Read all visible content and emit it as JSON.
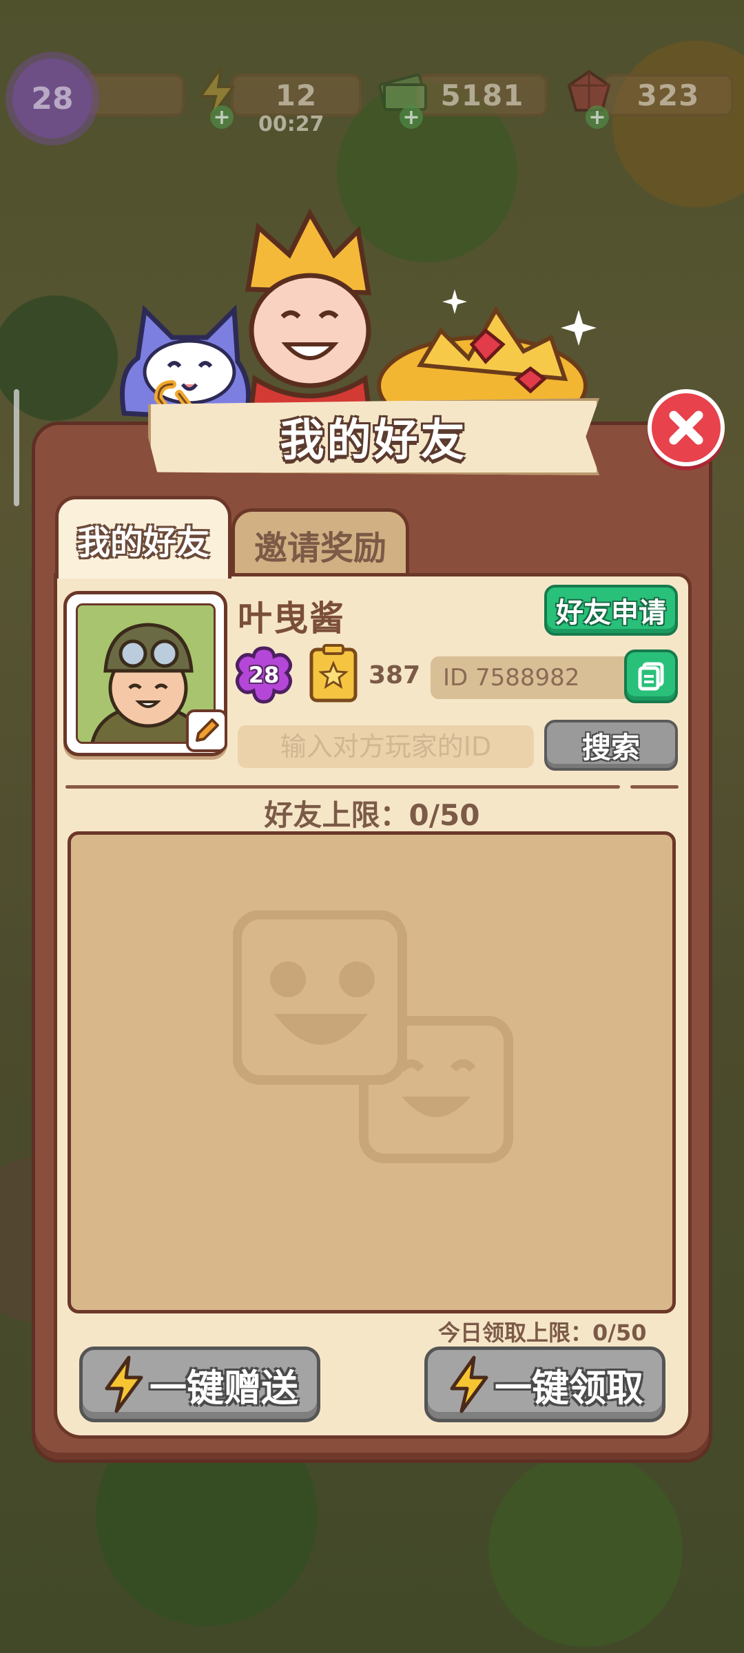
{
  "hud": {
    "level": "28",
    "energy": "12",
    "energy_timer": "00:27",
    "cash": "5181",
    "gems": "323"
  },
  "dialog": {
    "title": "我的好友",
    "tabs": [
      {
        "label": "我的好友",
        "active": true
      },
      {
        "label": "邀请奖励",
        "active": false
      }
    ]
  },
  "profile": {
    "name": "叶曳酱",
    "level": "28",
    "card_count": "387",
    "id_text": "ID 7588982"
  },
  "actions": {
    "friend_request_label": "好友申请",
    "search_placeholder": "输入对方玩家的ID",
    "search_button_label": "搜索",
    "friend_limit": "好友上限：0/50",
    "daily_claim_limit": "今日领取上限：0/50",
    "send_all_label": "一键赠送",
    "claim_all_label": "一键领取"
  },
  "colors": {
    "dialog_brown": "#8a4e3c",
    "panel_cream": "#f6e6c8",
    "accent_green": "#29c07a",
    "close_red": "#e8424d",
    "disabled_gray": "#a4a4a4"
  },
  "icons": [
    "level-flower-icon",
    "lightning-icon",
    "cash-icon",
    "ruby-icon",
    "close-icon",
    "edit-pencil-icon",
    "star-card-icon",
    "copy-icon",
    "empty-friends-icon"
  ]
}
